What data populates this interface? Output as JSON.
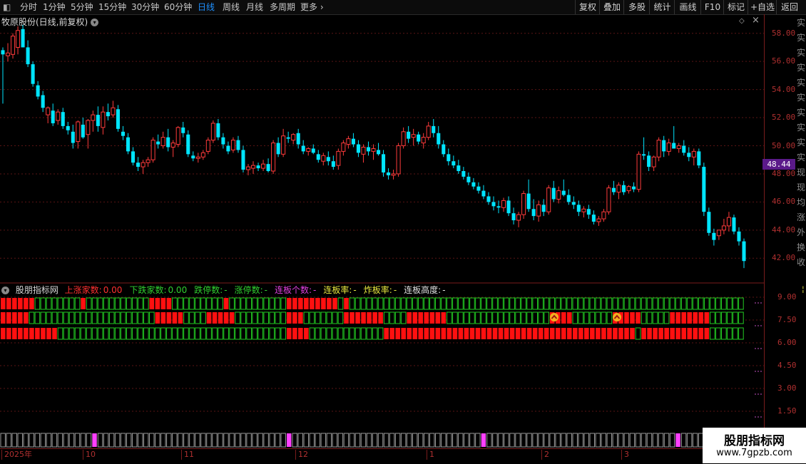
{
  "toolbar": {
    "periods": [
      "分时",
      "1分钟",
      "5分钟",
      "15分钟",
      "30分钟",
      "60分钟",
      "日线",
      "周线",
      "月线",
      "多周期",
      "更多"
    ],
    "active_period": "日线",
    "more_arrow": "›",
    "right_buttons": [
      "复权",
      "叠加",
      "多股",
      "统计",
      "画线",
      "F10",
      "标记",
      "+自选",
      "返回"
    ]
  },
  "stock": {
    "title": "牧原股份(日线,前复权)",
    "current_price": "48.44"
  },
  "price_axis": [
    "58.00",
    "56.00",
    "54.00",
    "52.00",
    "50.00",
    "48.00",
    "46.00",
    "44.00",
    "42.00"
  ],
  "indicator": {
    "name": "股朋指标网",
    "fields": [
      {
        "label": "上涨家数:",
        "value": "0.00",
        "color": "#ff3030"
      },
      {
        "label": "下跌家数:",
        "value": "0.00",
        "color": "#30d030"
      },
      {
        "label": "跌停数:",
        "value": "-",
        "color": "#30d030"
      },
      {
        "label": "涨停数:",
        "value": "-",
        "color": "#30d030"
      },
      {
        "label": "连板个数:",
        "value": "-",
        "color": "#e040e0"
      },
      {
        "label": "连板率:",
        "value": "-",
        "color": "#e8e840"
      },
      {
        "label": "炸板率:",
        "value": "-",
        "color": "#e8e840"
      },
      {
        "label": "连板高度:",
        "value": "-",
        "color": "#e0e0e0"
      }
    ],
    "axis": [
      "9.00",
      "7.50",
      "6.00",
      "4.50",
      "3.00",
      "1.50"
    ]
  },
  "dates": [
    {
      "label": "2025年",
      "x": 2
    },
    {
      "label": "10",
      "x": 116
    },
    {
      "label": "11",
      "x": 254
    },
    {
      "label": "12",
      "x": 414
    },
    {
      "label": "1",
      "x": 598
    },
    {
      "label": "2",
      "x": 759
    },
    {
      "label": "3",
      "x": 871
    }
  ],
  "right_column_glyphs": [
    "实",
    "实",
    "实",
    "实",
    "实",
    "实",
    "实",
    "实",
    "实",
    "实",
    "现",
    "现",
    "均",
    "涨",
    "外",
    "换",
    "收"
  ],
  "watermark": {
    "title": "股朋指标网",
    "url": "www.7gpzb.com"
  },
  "colors": {
    "up": "#ff3b3b",
    "down": "#00e5ff",
    "grid": "#5a1414",
    "row_red": "#ff1010",
    "row_green": "#22cc22",
    "magenta": "#ff40ff"
  },
  "chart_data": {
    "type": "candlestick",
    "ylim": [
      41,
      59
    ],
    "candles": [
      [
        56.8,
        57.0,
        53.0,
        56.5
      ],
      [
        56.4,
        57.3,
        56.0,
        56.6
      ],
      [
        56.5,
        58.0,
        56.2,
        57.8
      ],
      [
        57.0,
        58.5,
        56.5,
        58.2
      ],
      [
        58.3,
        58.6,
        57.0,
        57.0
      ],
      [
        57.0,
        57.5,
        55.6,
        55.8
      ],
      [
        55.8,
        56.0,
        54.2,
        54.4
      ],
      [
        54.3,
        54.6,
        53.3,
        53.5
      ],
      [
        53.6,
        53.9,
        52.4,
        52.7
      ],
      [
        52.2,
        52.8,
        51.6,
        52.7
      ],
      [
        52.5,
        53.0,
        51.4,
        51.6
      ],
      [
        51.8,
        52.6,
        51.5,
        52.4
      ],
      [
        52.4,
        52.7,
        51.2,
        51.4
      ],
      [
        51.4,
        51.7,
        50.8,
        51.1
      ],
      [
        51.0,
        51.5,
        49.8,
        50.2
      ],
      [
        50.3,
        51.8,
        49.8,
        51.7
      ],
      [
        51.5,
        52.0,
        50.5,
        50.6
      ],
      [
        50.8,
        51.9,
        49.8,
        51.8
      ],
      [
        51.8,
        52.5,
        51.0,
        52.2
      ],
      [
        52.2,
        52.8,
        51.0,
        51.4
      ],
      [
        51.3,
        52.8,
        50.8,
        52.4
      ],
      [
        52.4,
        53.0,
        51.8,
        52.1
      ],
      [
        52.2,
        53.2,
        52.0,
        52.7
      ],
      [
        52.6,
        52.9,
        51.0,
        51.2
      ],
      [
        51.0,
        51.4,
        50.4,
        50.7
      ],
      [
        50.6,
        50.9,
        49.4,
        49.6
      ],
      [
        49.6,
        49.9,
        48.6,
        48.8
      ],
      [
        48.8,
        49.2,
        48.2,
        48.5
      ],
      [
        48.5,
        49.0,
        48.0,
        48.8
      ],
      [
        48.8,
        49.2,
        48.5,
        49.0
      ],
      [
        49.0,
        50.6,
        48.8,
        50.4
      ],
      [
        50.3,
        50.8,
        49.8,
        50.1
      ],
      [
        50.0,
        51.0,
        49.8,
        50.6
      ],
      [
        50.6,
        51.2,
        49.6,
        49.9
      ],
      [
        49.9,
        50.4,
        49.2,
        50.2
      ],
      [
        50.1,
        51.4,
        49.9,
        51.3
      ],
      [
        51.3,
        51.7,
        50.6,
        50.9
      ],
      [
        50.8,
        51.1,
        49.2,
        49.4
      ],
      [
        49.3,
        49.6,
        48.9,
        49.1
      ],
      [
        49.1,
        49.5,
        48.8,
        49.2
      ],
      [
        49.2,
        49.7,
        49.0,
        49.5
      ],
      [
        49.6,
        50.6,
        49.4,
        50.4
      ],
      [
        50.4,
        51.8,
        50.2,
        51.6
      ],
      [
        51.6,
        51.9,
        50.4,
        50.6
      ],
      [
        50.6,
        50.9,
        49.8,
        50.1
      ],
      [
        50.0,
        50.3,
        49.4,
        49.6
      ],
      [
        49.7,
        50.6,
        49.5,
        50.4
      ],
      [
        50.4,
        50.7,
        49.5,
        49.7
      ],
      [
        49.7,
        50.0,
        48.1,
        48.3
      ],
      [
        48.3,
        48.7,
        47.9,
        48.5
      ],
      [
        48.4,
        48.9,
        48.0,
        48.6
      ],
      [
        48.6,
        48.8,
        48.2,
        48.4
      ],
      [
        48.4,
        49.0,
        48.2,
        48.7
      ],
      [
        48.7,
        49.1,
        48.1,
        48.2
      ],
      [
        48.2,
        50.4,
        48.0,
        50.2
      ],
      [
        50.2,
        50.6,
        49.2,
        49.4
      ],
      [
        49.4,
        51.2,
        49.2,
        50.7
      ],
      [
        50.6,
        51.0,
        50.2,
        50.5
      ],
      [
        50.4,
        50.9,
        50.1,
        50.8
      ],
      [
        50.9,
        51.2,
        49.8,
        50.1
      ],
      [
        50.0,
        50.4,
        49.4,
        49.6
      ],
      [
        49.6,
        49.9,
        49.3,
        49.8
      ],
      [
        49.8,
        50.1,
        49.4,
        49.5
      ],
      [
        49.4,
        49.7,
        48.8,
        49.0
      ],
      [
        48.9,
        49.5,
        48.6,
        49.3
      ],
      [
        49.2,
        49.6,
        48.6,
        48.9
      ],
      [
        48.9,
        49.3,
        48.3,
        48.5
      ],
      [
        48.6,
        49.8,
        48.3,
        49.6
      ],
      [
        49.6,
        50.4,
        49.3,
        50.2
      ],
      [
        50.1,
        50.7,
        49.8,
        50.5
      ],
      [
        50.5,
        50.9,
        49.9,
        50.1
      ],
      [
        50.1,
        50.4,
        49.2,
        49.5
      ],
      [
        49.4,
        50.1,
        48.8,
        49.9
      ],
      [
        49.9,
        50.3,
        49.3,
        49.6
      ],
      [
        49.6,
        50.1,
        49.0,
        49.8
      ],
      [
        49.7,
        50.2,
        49.3,
        49.4
      ],
      [
        49.4,
        49.7,
        47.8,
        48.1
      ],
      [
        48.1,
        48.4,
        47.6,
        47.9
      ],
      [
        47.9,
        48.3,
        47.6,
        48.0
      ],
      [
        48.0,
        50.2,
        47.8,
        50.0
      ],
      [
        50.0,
        51.3,
        49.8,
        51.0
      ],
      [
        51.0,
        51.4,
        50.2,
        50.5
      ],
      [
        50.6,
        51.2,
        50.0,
        50.8
      ],
      [
        50.8,
        51.0,
        50.1,
        50.3
      ],
      [
        50.2,
        50.9,
        49.8,
        50.6
      ],
      [
        50.6,
        51.7,
        50.4,
        51.4
      ],
      [
        51.4,
        51.9,
        50.6,
        50.9
      ],
      [
        50.9,
        51.4,
        49.8,
        50.1
      ],
      [
        50.1,
        50.4,
        49.2,
        49.4
      ],
      [
        49.4,
        49.8,
        48.6,
        48.9
      ],
      [
        48.9,
        49.3,
        48.4,
        48.6
      ],
      [
        48.6,
        49.0,
        48.0,
        48.2
      ],
      [
        48.2,
        48.5,
        47.6,
        47.8
      ],
      [
        47.8,
        48.1,
        47.2,
        47.4
      ],
      [
        47.4,
        47.7,
        46.9,
        47.1
      ],
      [
        47.1,
        47.4,
        46.6,
        46.8
      ],
      [
        46.8,
        47.2,
        46.2,
        46.4
      ],
      [
        46.4,
        46.7,
        45.8,
        46.0
      ],
      [
        46.0,
        46.4,
        45.4,
        45.7
      ],
      [
        45.7,
        46.1,
        45.2,
        45.6
      ],
      [
        45.6,
        46.3,
        45.3,
        46.1
      ],
      [
        46.1,
        46.4,
        45.0,
        45.2
      ],
      [
        45.2,
        45.6,
        44.4,
        44.7
      ],
      [
        44.7,
        45.3,
        44.2,
        45.1
      ],
      [
        45.1,
        46.8,
        44.8,
        46.6
      ],
      [
        46.6,
        47.6,
        45.3,
        45.5
      ],
      [
        45.5,
        46.2,
        44.7,
        45.0
      ],
      [
        45.0,
        46.1,
        44.6,
        45.8
      ],
      [
        45.8,
        46.2,
        45.0,
        45.3
      ],
      [
        45.3,
        47.2,
        45.1,
        47.0
      ],
      [
        47.0,
        47.5,
        46.0,
        46.2
      ],
      [
        46.2,
        47.1,
        45.9,
        46.8
      ],
      [
        46.8,
        47.6,
        46.4,
        46.5
      ],
      [
        46.5,
        46.9,
        45.8,
        46.0
      ],
      [
        46.0,
        46.4,
        45.5,
        45.8
      ],
      [
        45.8,
        46.1,
        45.0,
        45.3
      ],
      [
        45.3,
        45.7,
        44.9,
        45.5
      ],
      [
        45.5,
        45.8,
        44.8,
        45.1
      ],
      [
        45.1,
        45.4,
        44.4,
        44.6
      ],
      [
        44.6,
        45.0,
        44.3,
        44.8
      ],
      [
        44.8,
        45.5,
        44.6,
        45.3
      ],
      [
        45.3,
        47.2,
        45.1,
        47.0
      ],
      [
        47.0,
        47.5,
        46.5,
        46.7
      ],
      [
        46.7,
        47.4,
        46.2,
        47.2
      ],
      [
        47.2,
        47.5,
        46.5,
        46.7
      ],
      [
        46.8,
        47.2,
        46.6,
        47.1
      ],
      [
        47.1,
        47.4,
        46.7,
        46.9
      ],
      [
        46.9,
        49.6,
        46.7,
        49.4
      ],
      [
        49.4,
        50.6,
        49.0,
        49.3
      ],
      [
        49.3,
        49.6,
        48.2,
        48.5
      ],
      [
        48.5,
        49.3,
        48.2,
        49.2
      ],
      [
        49.2,
        50.6,
        48.9,
        50.4
      ],
      [
        50.4,
        50.7,
        49.2,
        49.6
      ],
      [
        49.6,
        50.5,
        49.3,
        50.2
      ],
      [
        50.2,
        51.4,
        49.9,
        49.8
      ],
      [
        49.8,
        50.2,
        49.5,
        50.0
      ],
      [
        50.0,
        50.4,
        49.3,
        49.5
      ],
      [
        49.5,
        49.9,
        48.9,
        49.2
      ],
      [
        49.2,
        49.8,
        48.6,
        49.6
      ],
      [
        49.6,
        49.8,
        48.4,
        48.6
      ],
      [
        48.5,
        48.8,
        45.0,
        45.3
      ],
      [
        45.3,
        45.6,
        43.6,
        43.8
      ],
      [
        43.8,
        44.1,
        42.9,
        43.3
      ],
      [
        43.6,
        44.0,
        43.3,
        44.0
      ],
      [
        44.0,
        44.8,
        43.7,
        44.3
      ],
      [
        44.3,
        45.3,
        43.9,
        44.9
      ],
      [
        44.9,
        45.1,
        43.7,
        43.9
      ],
      [
        43.9,
        44.2,
        42.9,
        43.2
      ],
      [
        43.2,
        43.4,
        41.3,
        41.8
      ]
    ]
  }
}
